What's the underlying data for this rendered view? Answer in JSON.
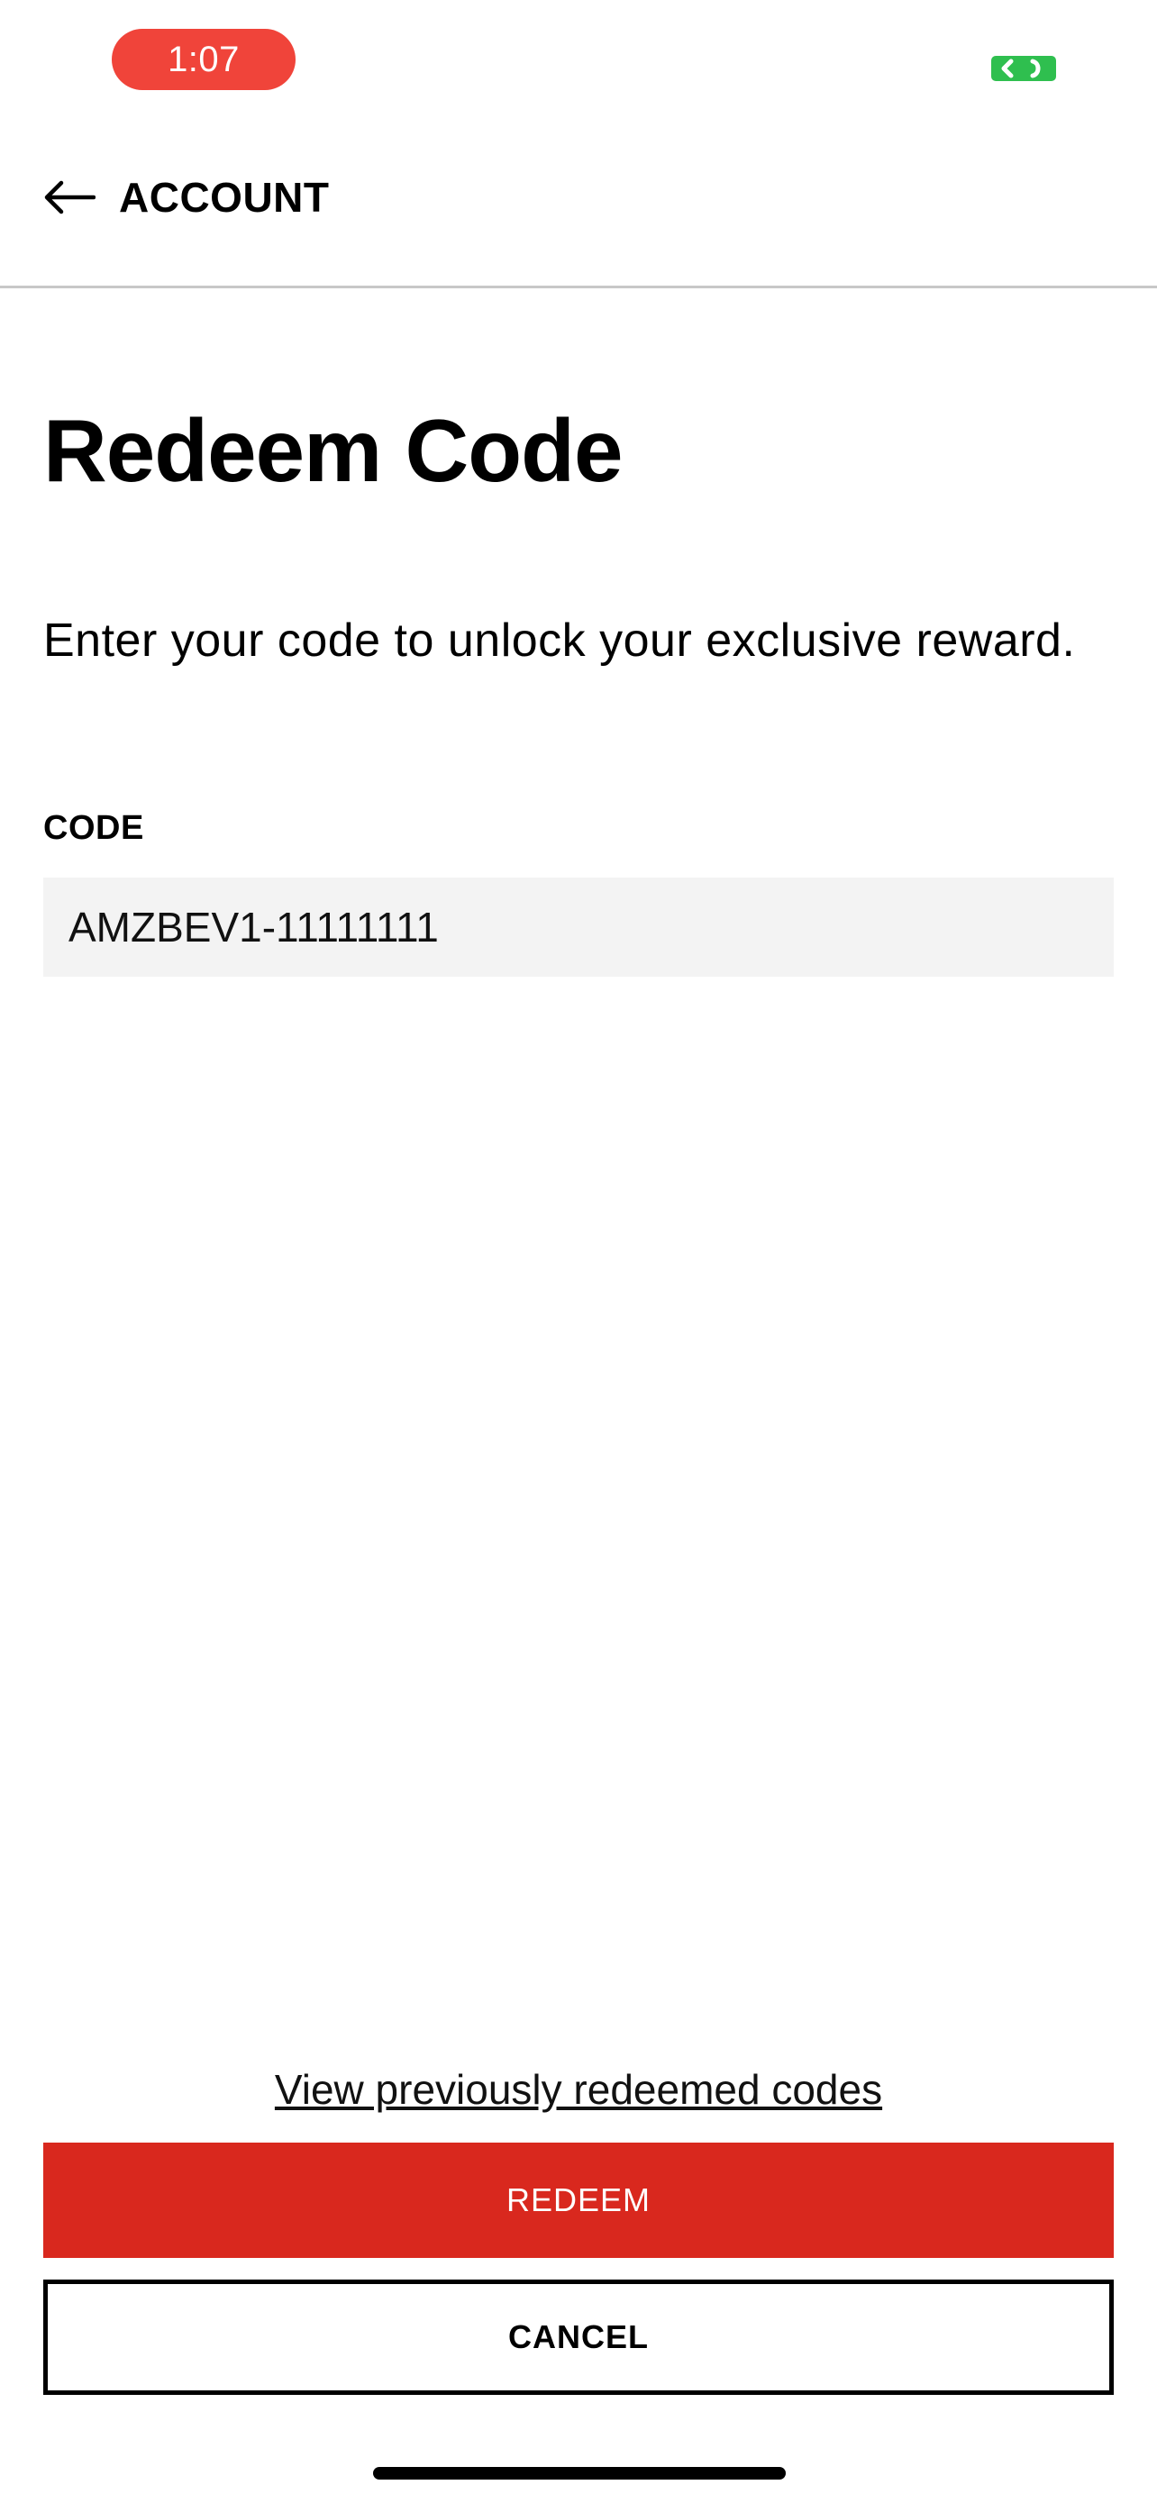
{
  "status_bar": {
    "time": "1:07",
    "time_pill_color": "#f0443a",
    "indicator_icon": "screen-share-icon",
    "indicator_color": "#2fbf4f"
  },
  "nav": {
    "back_icon": "arrow-left-icon",
    "back_label": "ACCOUNT"
  },
  "page": {
    "title": "Redeem Code",
    "description": "Enter your code to unlock your exclusive reward."
  },
  "form": {
    "code_label": "CODE",
    "code_value": "AMZBEV1-11111111"
  },
  "actions": {
    "history_link": "View previously redeemed codes",
    "redeem_label": "REDEEM",
    "cancel_label": "CANCEL",
    "accent_color": "#d9281e"
  }
}
